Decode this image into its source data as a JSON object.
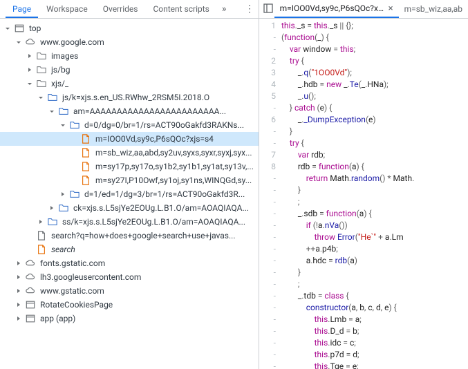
{
  "tabs": {
    "page": "Page",
    "workspace": "Workspace",
    "overrides": "Overrides",
    "content_scripts": "Content scripts",
    "overflow": "»",
    "kebab": "⋮"
  },
  "tree": {
    "top": "top",
    "google": "www.google.com",
    "images": "images",
    "jsbg": "js/bg",
    "xjs": "xjs/_",
    "jsk": "js/k=xjs.s.en_US.RWhw_2RSM5I.2018.O",
    "am": "am=AAAAAAAAAAAAAAAAAAAAAAAA...",
    "d0": "d=0/dg=0/br=1/rs=ACT90oGakfd3RAKNs...",
    "f1": "m=IOO0Vd,sy9c,P6sQOc?xjs=s4",
    "f2": "m=sb_wiz,aa,abd,sy2uv,syxs,syxr,syxj,syx...",
    "f3": "m=sy17p,sy17o,sy1b2,sy1b1,sy1at,sy13v,...",
    "f4": "m=sy27I,P10Owf,sy1oj,sy1ns,WINQGd,sy...",
    "d1": "d=1/ed=1/dg=3/br=1/rs=ACT90oGakfd3R...",
    "ck": "ck=xjs.s.L5sjYe2EOUg.L.B1.O/am=AOAQIAQA...",
    "ssk": "ss/k=xjs.s.L5sjYe2EOUg.L.B1.O/am=AOAQIAQA...",
    "searchq": "search?q=how+does+google+search+use+javas...",
    "search": "search",
    "fonts": "fonts.gstatic.com",
    "lh3": "lh3.googleusercontent.com",
    "gstatic": "www.gstatic.com",
    "rotate": "RotateCookiesPage",
    "app": "app (app)"
  },
  "editor_tabs": {
    "t1": "m=IOO0Vd,sy9c,P6sQOc?xjs=s4",
    "t2": "m=sb_wiz,aa,ab"
  },
  "gutter": [
    "1",
    "-",
    "-",
    "2",
    "3",
    "4",
    "5",
    "-",
    "6",
    "-",
    "-",
    "7",
    "8",
    "-",
    "-",
    "-",
    "-",
    "-",
    "-",
    "-",
    "-",
    "-",
    "-",
    "-",
    "-",
    "-",
    "-",
    "-",
    "-",
    "-"
  ],
  "code_lines": [
    [
      [
        "k",
        "this"
      ],
      [
        "p",
        "."
      ],
      [
        "n",
        "_s"
      ],
      [
        "p",
        " = "
      ],
      [
        "k",
        "this"
      ],
      [
        "p",
        "."
      ],
      [
        "n",
        "_s"
      ],
      [
        "p",
        " || {};"
      ]
    ],
    [
      [
        "p",
        "("
      ],
      [
        "k",
        "function"
      ],
      [
        "p",
        "("
      ],
      [
        "n",
        "_"
      ],
      [
        "p",
        ") {"
      ]
    ],
    [
      [
        "p",
        "    "
      ],
      [
        "k",
        "var"
      ],
      [
        "p",
        " "
      ],
      [
        "n",
        "window"
      ],
      [
        "p",
        " = "
      ],
      [
        "k",
        "this"
      ],
      [
        "p",
        ";"
      ]
    ],
    [
      [
        "p",
        "    "
      ],
      [
        "k",
        "try"
      ],
      [
        "p",
        " {"
      ]
    ],
    [
      [
        "p",
        "        "
      ],
      [
        "n",
        "_"
      ],
      [
        "p",
        "."
      ],
      [
        "s",
        "q"
      ],
      [
        "p",
        "("
      ],
      [
        "str",
        "\"1OO0Vd\""
      ],
      [
        "p",
        ");"
      ]
    ],
    [
      [
        "p",
        "        "
      ],
      [
        "n",
        "_"
      ],
      [
        "p",
        "."
      ],
      [
        "n",
        "hdb"
      ],
      [
        "p",
        " = "
      ],
      [
        "k",
        "new"
      ],
      [
        "p",
        " "
      ],
      [
        "n",
        "_"
      ],
      [
        "p",
        "."
      ],
      [
        "s",
        "Te"
      ],
      [
        "p",
        "("
      ],
      [
        "n",
        "_"
      ],
      [
        "p",
        "."
      ],
      [
        "n",
        "HNa"
      ],
      [
        "p",
        ");"
      ]
    ],
    [
      [
        "p",
        "        "
      ],
      [
        "n",
        "_"
      ],
      [
        "p",
        "."
      ],
      [
        "s",
        "u"
      ],
      [
        "p",
        "();"
      ]
    ],
    [
      [
        "p",
        "    } "
      ],
      [
        "k",
        "catch"
      ],
      [
        "p",
        " ("
      ],
      [
        "n",
        "e"
      ],
      [
        "p",
        ") {"
      ]
    ],
    [
      [
        "p",
        "        "
      ],
      [
        "n",
        "_"
      ],
      [
        "p",
        "."
      ],
      [
        "s",
        "_DumpException"
      ],
      [
        "p",
        "("
      ],
      [
        "n",
        "e"
      ],
      [
        "p",
        ")"
      ]
    ],
    [
      [
        "p",
        "    }"
      ]
    ],
    [
      [
        "p",
        "    "
      ],
      [
        "k",
        "try"
      ],
      [
        "p",
        " {"
      ]
    ],
    [
      [
        "p",
        "        "
      ],
      [
        "k",
        "var"
      ],
      [
        "p",
        " "
      ],
      [
        "n",
        "rdb"
      ],
      [
        "p",
        ";"
      ]
    ],
    [
      [
        "p",
        "        "
      ],
      [
        "n",
        "rdb"
      ],
      [
        "p",
        " = "
      ],
      [
        "k",
        "function"
      ],
      [
        "p",
        "("
      ],
      [
        "n",
        "a"
      ],
      [
        "p",
        ") {"
      ]
    ],
    [
      [
        "p",
        "            "
      ],
      [
        "k",
        "return"
      ],
      [
        "p",
        " "
      ],
      [
        "n",
        "Math"
      ],
      [
        "p",
        "."
      ],
      [
        "s",
        "random"
      ],
      [
        "p",
        "() * "
      ],
      [
        "n",
        "Math"
      ],
      [
        "p",
        "."
      ]
    ],
    [
      [
        "p",
        "        }"
      ]
    ],
    [
      [
        "p",
        "        ;"
      ]
    ],
    [
      [
        "p",
        "        "
      ],
      [
        "n",
        "_"
      ],
      [
        "p",
        "."
      ],
      [
        "n",
        "sdb"
      ],
      [
        "p",
        " = "
      ],
      [
        "k",
        "function"
      ],
      [
        "p",
        "("
      ],
      [
        "n",
        "a"
      ],
      [
        "p",
        ") {"
      ]
    ],
    [
      [
        "p",
        "            "
      ],
      [
        "k",
        "if"
      ],
      [
        "p",
        " (!"
      ],
      [
        "n",
        "a"
      ],
      [
        "p",
        "."
      ],
      [
        "s",
        "nVa"
      ],
      [
        "p",
        "())"
      ]
    ],
    [
      [
        "p",
        "                "
      ],
      [
        "k",
        "throw"
      ],
      [
        "p",
        " "
      ],
      [
        "s",
        "Error"
      ],
      [
        "p",
        "("
      ],
      [
        "str",
        "\"He`\""
      ],
      [
        "p",
        " + "
      ],
      [
        "n",
        "a"
      ],
      [
        "p",
        "."
      ],
      [
        "n",
        "Lm"
      ]
    ],
    [
      [
        "p",
        "            ++"
      ],
      [
        "n",
        "a"
      ],
      [
        "p",
        "."
      ],
      [
        "n",
        "p4b"
      ],
      [
        "p",
        ";"
      ]
    ],
    [
      [
        "p",
        "            "
      ],
      [
        "n",
        "a"
      ],
      [
        "p",
        "."
      ],
      [
        "n",
        "hdc"
      ],
      [
        "p",
        " = "
      ],
      [
        "s",
        "rdb"
      ],
      [
        "p",
        "("
      ],
      [
        "n",
        "a"
      ],
      [
        "p",
        ")"
      ]
    ],
    [
      [
        "p",
        "        }"
      ]
    ],
    [
      [
        "p",
        "        ;"
      ]
    ],
    [
      [
        "p",
        "        "
      ],
      [
        "n",
        "_"
      ],
      [
        "p",
        "."
      ],
      [
        "n",
        "tdb"
      ],
      [
        "p",
        " = "
      ],
      [
        "k",
        "class"
      ],
      [
        "p",
        " {"
      ]
    ],
    [
      [
        "p",
        "            "
      ],
      [
        "s",
        "constructor"
      ],
      [
        "p",
        "("
      ],
      [
        "n",
        "a"
      ],
      [
        "p",
        ", "
      ],
      [
        "n",
        "b"
      ],
      [
        "p",
        ", "
      ],
      [
        "n",
        "c"
      ],
      [
        "p",
        ", "
      ],
      [
        "n",
        "d"
      ],
      [
        "p",
        ", "
      ],
      [
        "n",
        "e"
      ],
      [
        "p",
        ") {"
      ]
    ],
    [
      [
        "p",
        "                "
      ],
      [
        "k",
        "this"
      ],
      [
        "p",
        "."
      ],
      [
        "n",
        "Lmb"
      ],
      [
        "p",
        " = "
      ],
      [
        "n",
        "a"
      ],
      [
        "p",
        ";"
      ]
    ],
    [
      [
        "p",
        "                "
      ],
      [
        "k",
        "this"
      ],
      [
        "p",
        "."
      ],
      [
        "n",
        "D_d"
      ],
      [
        "p",
        " = "
      ],
      [
        "n",
        "b"
      ],
      [
        "p",
        ";"
      ]
    ],
    [
      [
        "p",
        "                "
      ],
      [
        "k",
        "this"
      ],
      [
        "p",
        "."
      ],
      [
        "n",
        "idc"
      ],
      [
        "p",
        " = "
      ],
      [
        "n",
        "c"
      ],
      [
        "p",
        ";"
      ]
    ],
    [
      [
        "p",
        "                "
      ],
      [
        "k",
        "this"
      ],
      [
        "p",
        "."
      ],
      [
        "n",
        "p7d"
      ],
      [
        "p",
        " = "
      ],
      [
        "n",
        "d"
      ],
      [
        "p",
        ";"
      ]
    ],
    [
      [
        "p",
        "                "
      ],
      [
        "k",
        "this"
      ],
      [
        "p",
        "."
      ],
      [
        "n",
        "Tge"
      ],
      [
        "p",
        " = "
      ],
      [
        "n",
        "e"
      ],
      [
        "p",
        ";"
      ]
    ]
  ]
}
